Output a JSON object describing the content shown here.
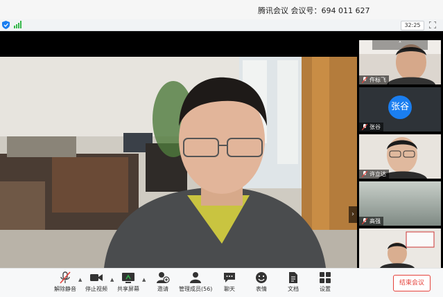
{
  "window": {
    "title": "腾讯会议 会议号：694 011 627"
  },
  "status": {
    "elapsed_time": "32:25",
    "icons": [
      "shield-icon",
      "signal-icon",
      "fullscreen-icon"
    ]
  },
  "participants": [
    {
      "name": "仵标飞",
      "has_video": true
    },
    {
      "name": "张谷",
      "has_video": false,
      "avatar_text": "张谷"
    },
    {
      "name": "许立达",
      "has_video": true
    },
    {
      "name": "高强",
      "has_video": true
    },
    {
      "name": "",
      "has_video": true
    }
  ],
  "toolbar": {
    "unmute_label": "解除静音",
    "stop_video_label": "停止视频",
    "share_screen_label": "共享屏幕",
    "invite_label": "邀请",
    "manage_members_label": "管理成员(56)",
    "chat_label": "聊天",
    "emoji_label": "表情",
    "docs_label": "文档",
    "settings_label": "设置",
    "end_meeting_label": "结束会议"
  },
  "colors": {
    "accent_blue": "#1a7ef0",
    "end_red": "#e5413a",
    "signal_green": "#35b84a"
  }
}
